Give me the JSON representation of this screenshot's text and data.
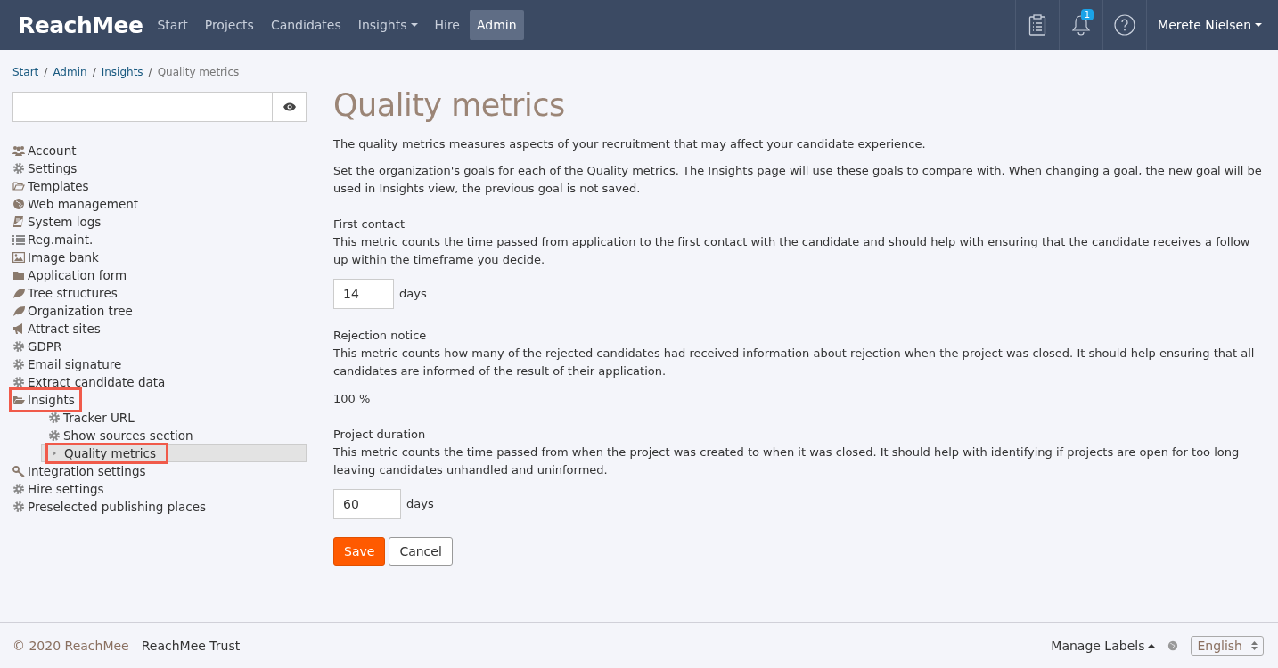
{
  "navbar": {
    "logo": "ReachMee",
    "items": [
      {
        "label": "Start",
        "selected": false,
        "dropdown": false
      },
      {
        "label": "Projects",
        "selected": false,
        "dropdown": false
      },
      {
        "label": "Candidates",
        "selected": false,
        "dropdown": false
      },
      {
        "label": "Insights",
        "selected": false,
        "dropdown": true
      },
      {
        "label": "Hire",
        "selected": false,
        "dropdown": false
      },
      {
        "label": "Admin",
        "selected": true,
        "dropdown": false
      }
    ],
    "notification_count": "1",
    "user": "Merete Nielsen"
  },
  "breadcrumb": {
    "links": [
      "Start",
      "Admin",
      "Insights"
    ],
    "separator": "/",
    "current": "Quality metrics"
  },
  "sidebar": {
    "items": [
      {
        "label": "Account",
        "kind": "users",
        "selected": false,
        "highlighted": false
      },
      {
        "label": "Settings",
        "kind": "gear",
        "selected": false,
        "highlighted": false
      },
      {
        "label": "Templates",
        "kind": "folder-open",
        "selected": false,
        "highlighted": false
      },
      {
        "label": "Web management",
        "kind": "globe",
        "selected": false,
        "highlighted": false
      },
      {
        "label": "System logs",
        "kind": "book",
        "selected": false,
        "highlighted": false
      },
      {
        "label": "Reg.maint.",
        "kind": "list",
        "selected": false,
        "highlighted": false
      },
      {
        "label": "Image bank",
        "kind": "image",
        "selected": false,
        "highlighted": false
      },
      {
        "label": "Application form",
        "kind": "folder",
        "selected": false,
        "highlighted": false
      },
      {
        "label": "Tree structures",
        "kind": "leaf",
        "selected": false,
        "highlighted": false
      },
      {
        "label": "Organization tree",
        "kind": "leaf",
        "selected": false,
        "highlighted": false
      },
      {
        "label": "Attract sites",
        "kind": "megaphone",
        "selected": false,
        "highlighted": false
      },
      {
        "label": "GDPR",
        "kind": "gear",
        "selected": false,
        "highlighted": false
      },
      {
        "label": "Email signature",
        "kind": "gear",
        "selected": false,
        "highlighted": false
      },
      {
        "label": "Extract candidate data",
        "kind": "gear",
        "selected": false,
        "highlighted": false
      },
      {
        "label": "Insights",
        "kind": "folder-open-filled",
        "selected": false,
        "highlighted": true,
        "children": [
          {
            "label": "Tracker URL",
            "kind": "gear",
            "selected": false,
            "highlighted": false
          },
          {
            "label": "Show sources section",
            "kind": "gear",
            "selected": false,
            "highlighted": false
          },
          {
            "label": "Quality metrics",
            "kind": "caret",
            "selected": true,
            "highlighted": true
          }
        ]
      },
      {
        "label": "Integration settings",
        "kind": "key",
        "selected": false,
        "highlighted": false
      },
      {
        "label": "Hire settings",
        "kind": "gear",
        "selected": false,
        "highlighted": false
      },
      {
        "label": "Preselected publishing places",
        "kind": "gear",
        "selected": false,
        "highlighted": false
      }
    ]
  },
  "main": {
    "title": "Quality metrics",
    "intro": [
      "The quality metrics measures aspects of your recruitment that may affect your candidate experience.",
      "Set the organization's goals for each of the Quality metrics. The Insights page will use these goals to compare with. When changing a goal, the new goal will be used in Insights view, the previous goal is not saved."
    ],
    "metrics": [
      {
        "kind": "input",
        "title": "First contact",
        "description": "This metric counts the time passed from application to the first contact with the candidate and should help with ensuring that the candidate receives a follow up within the timeframe you decide.",
        "value": "14",
        "unit": "days"
      },
      {
        "kind": "readonly",
        "title": "Rejection notice",
        "description": "This metric counts how many of the rejected candidates had received information about rejection when the project was closed. It should help ensuring that all candidates are informed of the result of their application.",
        "value": "100 %"
      },
      {
        "kind": "input",
        "title": "Project duration",
        "description": "This metric counts the time passed from when the project was created to when it was closed. It should help with identifying if projects are open for too long leaving candidates unhandled and uninformed.",
        "value": "60",
        "unit": "days"
      }
    ],
    "buttons": [
      "Save",
      "Cancel"
    ]
  },
  "footer": {
    "copyright": "© 2020 ReachMee",
    "company": "ReachMee Trust",
    "manage_labels": "Manage Labels",
    "language": "English"
  }
}
